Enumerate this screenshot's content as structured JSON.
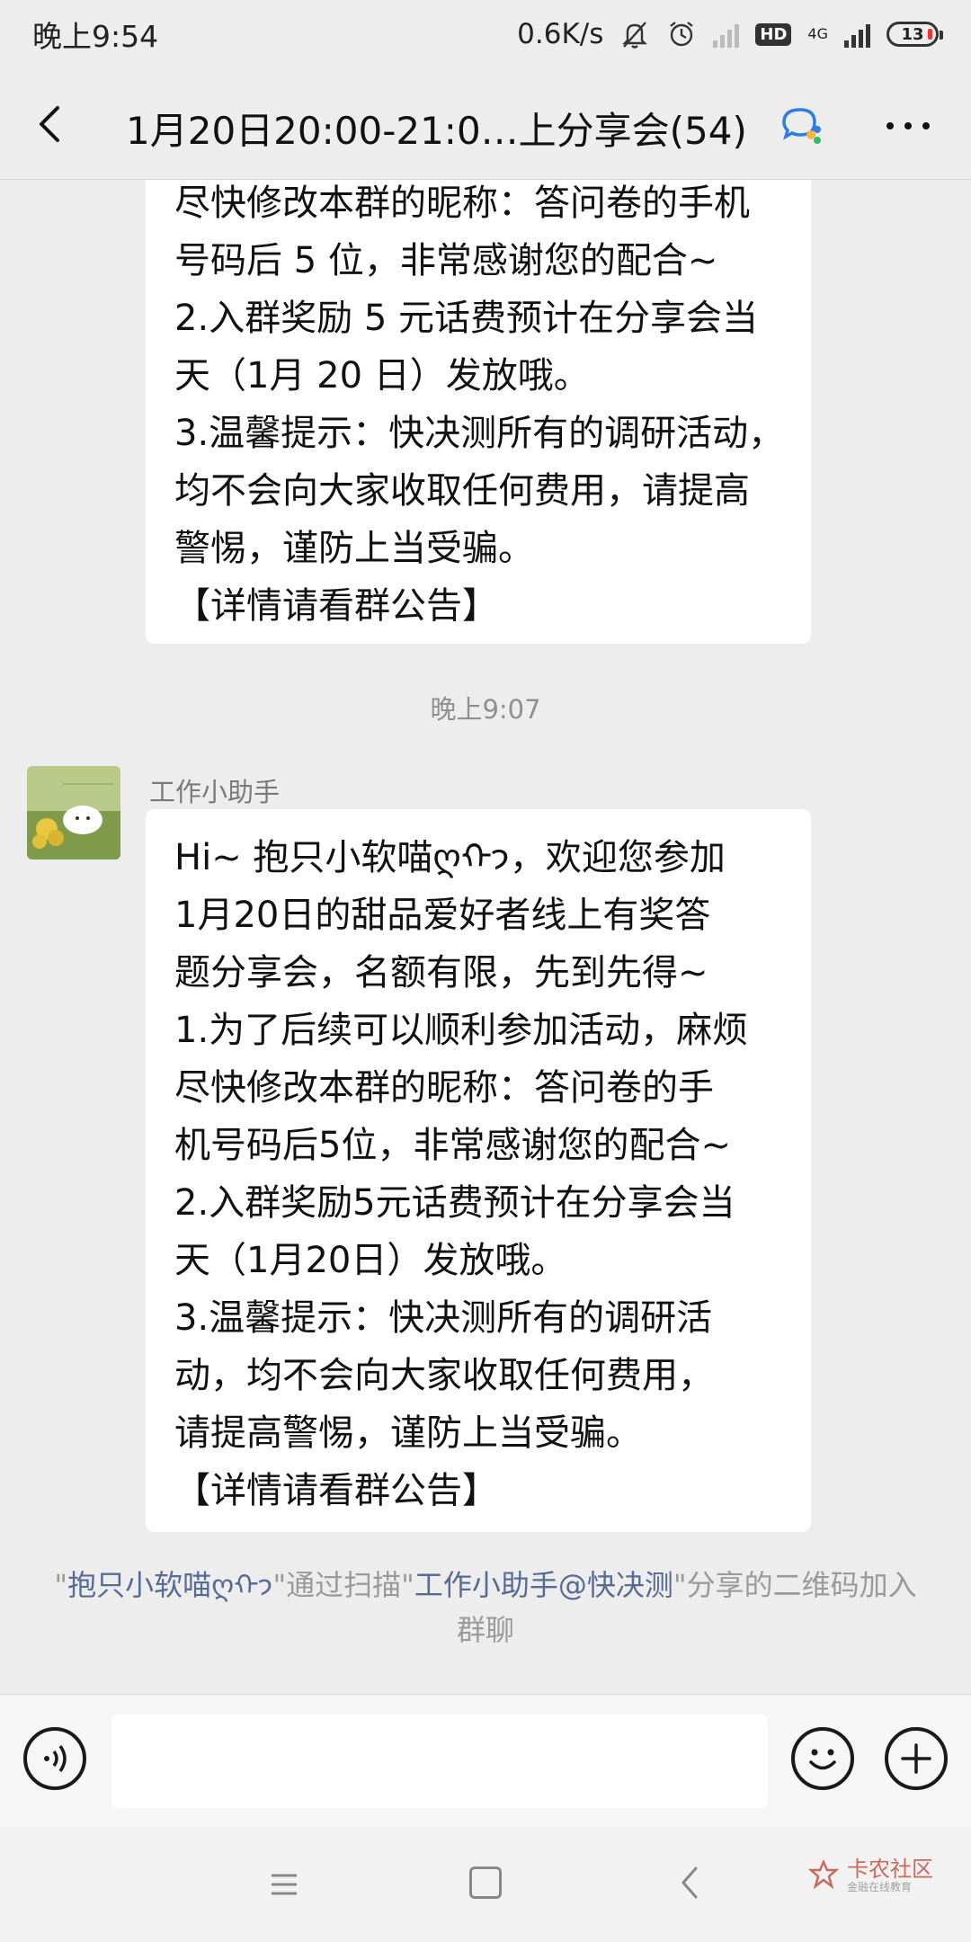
{
  "status_bar": {
    "time": "晚上9:54",
    "speed": "0.6K/s",
    "network": "4G",
    "hd": "HD",
    "battery": "13"
  },
  "header": {
    "title": "1月20日20:00-21:0…上分享会(54)"
  },
  "messages": [
    {
      "lines": [
        "尽快修改本群的昵称：答问卷的手机",
        "号码后 5 位，非常感谢您的配合~",
        "2.入群奖励 5 元话费预计在分享会当",
        "天（1月 20 日）发放哦。",
        "3.温馨提示：快决测所有的调研活动，",
        "均不会向大家收取任何费用，请提高",
        "警惕，谨防上当受骗。",
        "【详情请看群公告】"
      ]
    },
    {
      "sender": "工作小助手",
      "lines": [
        "Hi~ 抱只小软喵ღ⁠ᡣ𐭩，欢迎您参加",
        "1月20日的甜品爱好者线上有奖答",
        "题分享会，名额有限，先到先得~",
        "1.为了后续可以顺利参加活动，麻烦",
        "尽快修改本群的昵称：答问卷的手",
        "机号码后5位，非常感谢您的配合~",
        "2.入群奖励5元话费预计在分享会当",
        "天（1月20日）发放哦。",
        "3.温馨提示：快决测所有的调研活",
        "动，均不会向大家收取任何费用，",
        "请提高警惕，谨防上当受骗。",
        "【详情请看群公告】"
      ]
    }
  ],
  "time_divider": "晚上9:07",
  "system_message": {
    "quote_open": "\"",
    "user_name": "抱只小软喵ღ⁠ᡣ𐭩",
    "mid_text": "\"通过扫描\"",
    "qr_owner": "工作小助手@快决测",
    "tail_text": "\"分享的二维码加入群聊"
  },
  "input": {
    "placeholder": ""
  },
  "watermark": {
    "title": "卡农社区",
    "subtitle": "金融在线教育"
  },
  "colors": {
    "background": "#ededed",
    "bubble": "#ffffff",
    "link": "#576b95"
  }
}
